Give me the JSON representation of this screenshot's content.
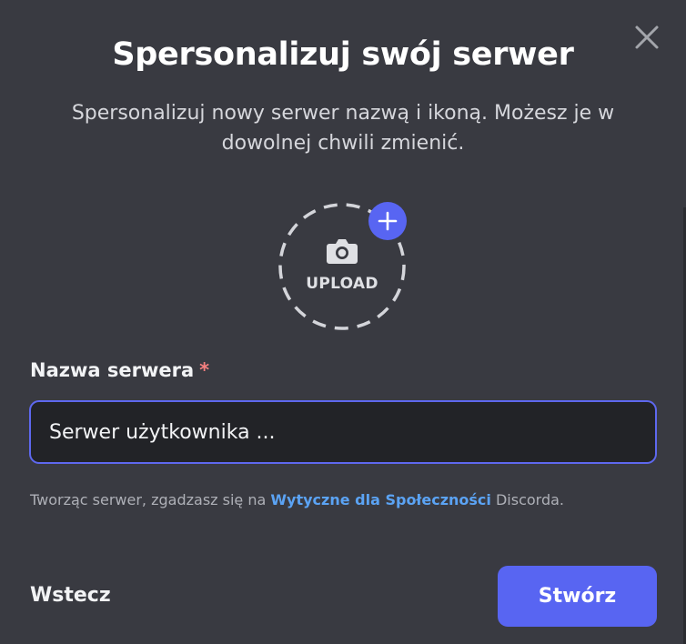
{
  "modal": {
    "title": "Spersonalizuj swój serwer",
    "subtitle": "Spersonalizuj nowy serwer nazwą i ikoną. Możesz je w dowolnej chwili zmienić.",
    "close_icon": "close-x-icon"
  },
  "upload": {
    "label": "UPLOAD",
    "camera_icon": "camera-icon",
    "plus_icon": "plus-icon"
  },
  "server_name": {
    "label": "Nazwa serwera",
    "required_mark": "*",
    "value": "Serwer użytkownika ..."
  },
  "terms": {
    "prefix": "Tworząc serwer, zgadzasz się na ",
    "link": "Wytyczne dla Społeczności",
    "suffix": " Discorda."
  },
  "footer": {
    "back_label": "Wstecz",
    "create_label": "Stwórz"
  },
  "colors": {
    "background": "#393a41",
    "accent": "#5865f2",
    "link": "#5ba3f4",
    "required": "#f57f7f",
    "input_bg": "#222327"
  }
}
